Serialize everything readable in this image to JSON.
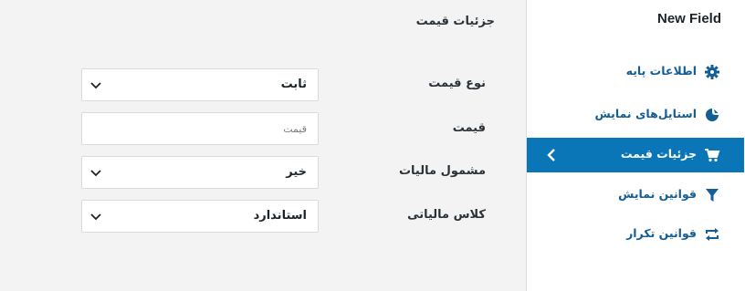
{
  "panel": {
    "section_title": "جزئیات قیمت",
    "rows": [
      {
        "label": "نوع قیمت",
        "value": "ثابت",
        "type": "select"
      },
      {
        "label": "قیمت",
        "placeholder": "قیمت",
        "type": "input"
      },
      {
        "label": "مشمول مالیات",
        "value": "خیر",
        "type": "select"
      },
      {
        "label": "کلاس مالیاتی",
        "value": "استاندارد",
        "type": "select"
      }
    ]
  },
  "sidebar": {
    "title": "New Field",
    "items": [
      {
        "label": "اطلاعات پایه",
        "icon": "gear-icon",
        "active": false
      },
      {
        "label": "استایل‌های نمایش",
        "icon": "palette-icon",
        "active": false
      },
      {
        "label": "جزئیات قیمت",
        "icon": "cart-icon",
        "active": true
      },
      {
        "label": "قوانین نمایش",
        "icon": "filter-icon",
        "active": false
      },
      {
        "label": "قوانین تکرار",
        "icon": "repeat-icon",
        "active": false
      }
    ]
  },
  "colors": {
    "accent": "#0a76b8",
    "link": "#135e96",
    "panel_bg": "#f3f3f4"
  }
}
